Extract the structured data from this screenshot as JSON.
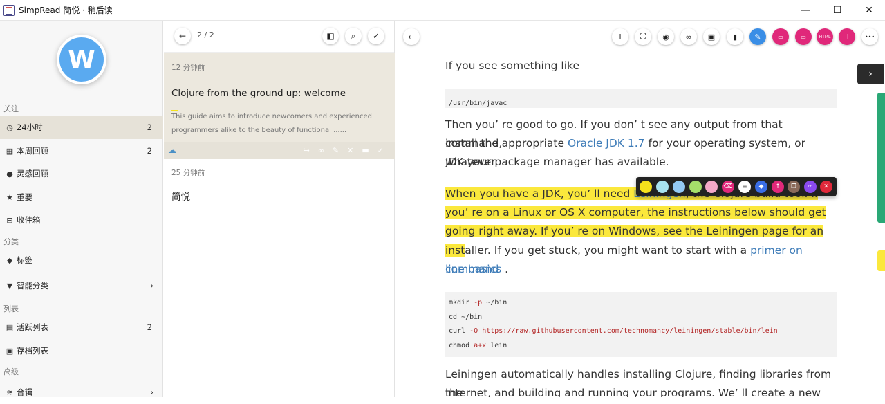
{
  "window": {
    "title": "SimpRead 简悦 · 稍后读",
    "minimize": "—",
    "maximize": "☐",
    "close": "✕"
  },
  "sidebar": {
    "avatar_letter": "W",
    "sections": {
      "follow": "关注",
      "category": "分类",
      "list": "列表",
      "advanced": "高级"
    },
    "items": [
      {
        "icon": "clock-icon",
        "glyph": "◷",
        "label": "24小时",
        "count": "2",
        "active": true
      },
      {
        "icon": "calendar-icon",
        "glyph": "▦",
        "label": "本周回顾",
        "count": "2"
      },
      {
        "icon": "bulb-icon",
        "glyph": "●",
        "label": "灵感回顾",
        "count": ""
      },
      {
        "icon": "star-icon",
        "glyph": "★",
        "label": "重要",
        "count": ""
      },
      {
        "icon": "inbox-icon",
        "glyph": "⊟",
        "label": "收件箱",
        "count": ""
      },
      {
        "icon": "tags-icon",
        "glyph": "◆",
        "label": "标签",
        "count": ""
      },
      {
        "icon": "filter-icon",
        "glyph": "▼",
        "label": "智能分类",
        "chevron": "›"
      },
      {
        "icon": "list-icon",
        "glyph": "▤",
        "label": "活跃列表",
        "count": "2"
      },
      {
        "icon": "archive-icon",
        "glyph": "▣",
        "label": "存档列表",
        "count": ""
      },
      {
        "icon": "layers-icon",
        "glyph": "≋",
        "label": "合辑",
        "chevron": "›"
      }
    ]
  },
  "middle": {
    "back": "←",
    "pager": "2 / 2",
    "layout_glyph": "◧",
    "search_glyph": "⌕",
    "check_glyph": "✓",
    "cards": [
      {
        "time": "12 分钟前",
        "title": "Clojure from the ground up: welcome",
        "desc": "This guide aims to introduce newcomers and experienced programmers alike to the beauty of functional ......",
        "actions": [
          "↪",
          "∞",
          "✎",
          "✕",
          "▬",
          "✓"
        ],
        "cloud": "☁"
      },
      {
        "time": "25 分钟前",
        "title": "简悦"
      }
    ]
  },
  "reader": {
    "back": "←",
    "tools": [
      {
        "name": "info-icon",
        "glyph": "i"
      },
      {
        "name": "fullscreen-icon",
        "glyph": "⛶"
      },
      {
        "name": "focus-icon",
        "glyph": "◉"
      },
      {
        "name": "link-icon",
        "glyph": "∞"
      },
      {
        "name": "archive-icon",
        "glyph": "▣"
      },
      {
        "name": "trash-icon",
        "glyph": "▮"
      },
      {
        "name": "pen-icon",
        "glyph": "✎",
        "style": "blue"
      },
      {
        "name": "export-1-icon",
        "glyph": "▭",
        "style": "pink"
      },
      {
        "name": "export-2-icon",
        "glyph": "▭",
        "style": "pink"
      },
      {
        "name": "html-icon",
        "glyph": "HTML",
        "style": "pink"
      },
      {
        "name": "pdf-icon",
        "glyph": "⅃",
        "style": "pink"
      },
      {
        "name": "more-icon",
        "glyph": "•••"
      }
    ],
    "p1": "If you see something like",
    "code1": "/usr/bin/javac",
    "p2_a": "Then you’ re good to go. If you don’ t see any output from that command,",
    "p2_b_pre": "install the appropriate ",
    "p2_b_link": "Oracle JDK 1.7",
    "p2_b_post": " for your operating system, or whatever",
    "p2_c": "JDK your package manager has available.",
    "p3_a_pre": "When you have a JDK, you’ ll need ",
    "p3_a_link": "Leiningen",
    "p3_a_post": ", the Clojure build tool. If",
    "p3_b": "you’ re on a Linux or OS X computer, the instructions below should get you",
    "p3_c": "going right away. If you’ re on Windows, see the Leiningen page for an",
    "p3_d_hl": "inst",
    "p3_d_rest": "aller. If you get stuck, you might want to start with a ",
    "p3_d_link": "primer on command",
    "p3_e_link": "line basics",
    "p3_e_post": " .",
    "code2": [
      {
        "cmd": "mkdir",
        "flag": "-p",
        "rest": " ~/bin"
      },
      {
        "cmd": "cd",
        "flag": "",
        "rest": " ~/bin"
      },
      {
        "cmd": "curl",
        "flag": "-O",
        "rest": " https://raw.githubusercontent.com/technomancy/leiningen/stable/bin/lein"
      },
      {
        "cmd": "chmod",
        "flag": "a+x",
        "rest": " lein"
      }
    ],
    "p4_a": "Leiningen automatically handles installing Clojure, finding libraries from the",
    "p4_b": "internet, and building and running your programs. We’ ll create a new",
    "side_tab": "›"
  },
  "highlight_toolbar": {
    "swatches": [
      "#f6e21c",
      "#a8e3f0",
      "#93c9f5",
      "#a5df6a",
      "#f4a9c8"
    ],
    "icons": [
      {
        "name": "eraser-icon",
        "glyph": "⌫",
        "bg": "#e0287a"
      },
      {
        "name": "note-icon",
        "glyph": "≡",
        "bg": "#ffffff",
        "fg": "#222"
      },
      {
        "name": "tag-icon",
        "glyph": "◆",
        "bg": "#3a6ee6"
      },
      {
        "name": "share-icon",
        "glyph": "↑",
        "bg": "#e0287a"
      },
      {
        "name": "copy-icon",
        "glyph": "❐",
        "bg": "#8a6a5a"
      },
      {
        "name": "link-icon",
        "glyph": "∞",
        "bg": "#8a4af0"
      },
      {
        "name": "remove-icon",
        "glyph": "✕",
        "bg": "#e0283a"
      }
    ]
  }
}
